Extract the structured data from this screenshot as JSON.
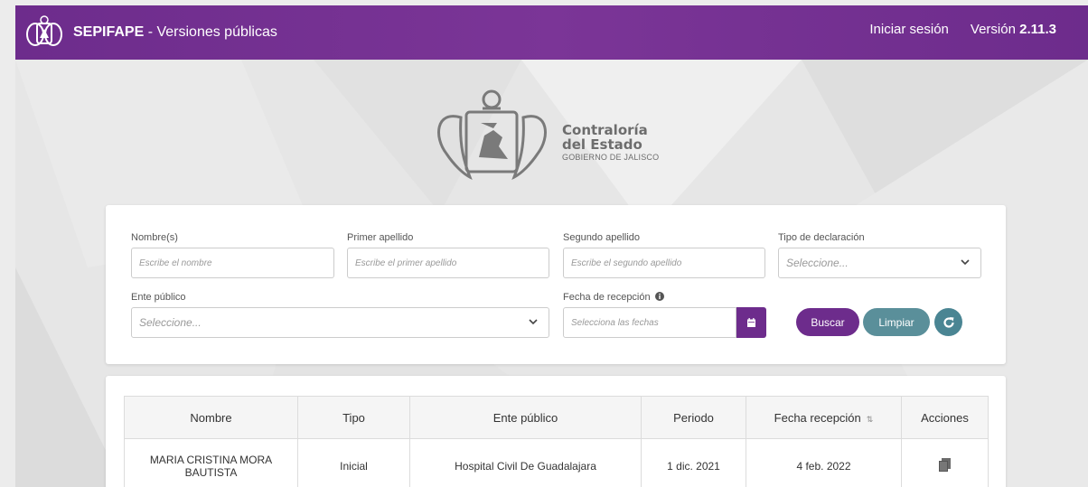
{
  "navbar": {
    "app_name": "SEPIFAPE",
    "subtitle": " - Versiones públicas",
    "login": "Iniciar sesión",
    "version_label": "Versión ",
    "version_number": "2.11.3"
  },
  "brand": {
    "line1": "Contraloría",
    "line2": "del Estado",
    "line3": "GOBIERNO DE JALISCO"
  },
  "filters": {
    "nombre": {
      "label": "Nombre(s)",
      "placeholder": "Escribe el nombre"
    },
    "primer_apellido": {
      "label": "Primer apellido",
      "placeholder": "Escribe el primer apellido"
    },
    "segundo_apellido": {
      "label": "Segundo apellido",
      "placeholder": "Escribe el segundo apellido"
    },
    "tipo_declaracion": {
      "label": "Tipo de declaración",
      "placeholder": "Seleccione..."
    },
    "ente_publico": {
      "label": "Ente público",
      "placeholder": "Seleccione..."
    },
    "fecha_recepcion": {
      "label": "Fecha de recepción",
      "placeholder": "Selecciona las fechas"
    },
    "buscar": "Buscar",
    "limpiar": "Limpiar"
  },
  "table": {
    "columns": [
      "Nombre",
      "Tipo",
      "Ente público",
      "Periodo",
      "Fecha recepción",
      "Acciones"
    ],
    "rows": [
      {
        "nombre": "MARIA CRISTINA MORA BAUTISTA",
        "tipo": "Inicial",
        "ente": "Hospital Civil De Guadalajara",
        "periodo": "1 dic. 2021",
        "fecha": "4 feb. 2022"
      }
    ]
  },
  "colors": {
    "primary": "#6d2c8c",
    "secondary": "#5a8f9a"
  }
}
